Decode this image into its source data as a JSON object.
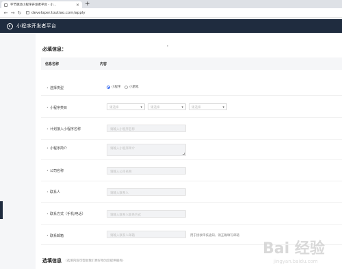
{
  "browser": {
    "tab_title": "字节跳动小程序开发者平台 - 小...",
    "tab_close": "×",
    "new_tab": "+",
    "nav": [
      "←",
      "→",
      "↻"
    ],
    "url": "developer.toutiao.com/apply"
  },
  "header": {
    "title": "小程序开发者平台"
  },
  "form": {
    "section_required": "必填信息：",
    "col_name": "信息名称",
    "col_content": "内容",
    "fields": [
      {
        "label": "选择类型"
      },
      {
        "label": "小程序类目"
      },
      {
        "label": "计划接入小程序名称"
      },
      {
        "label": "小程序简介"
      },
      {
        "label": "公司名称"
      },
      {
        "label": "联系人"
      },
      {
        "label": "联系方式（手机/电话）"
      },
      {
        "label": "联系邮箱"
      }
    ],
    "type_options": [
      "小程序",
      "小游戏"
    ],
    "category_placeholders": [
      "请选择",
      "请选择",
      "请选择"
    ],
    "name_placeholder": "请输入小程序名称",
    "intro_placeholder": "请输入小程序简介",
    "company_placeholder": "请输入公司名称",
    "contact_placeholder": "请输入联系人",
    "phone_placeholder": "请输入联系人联系方式",
    "email_placeholder": "请输入联系人邮箱",
    "email_hint": "用于接收审核通知，请正确填写邮箱",
    "section_optional": "选填信息",
    "optional_hint": "(选填内容可帮助我们更好地为您提供服务)"
  },
  "watermark": {
    "text": "Bai 经验",
    "sub": "jingyan.baidu.com"
  },
  "colors": {
    "header_bg": "#1f2c3f",
    "accent": "#3a6df0"
  }
}
